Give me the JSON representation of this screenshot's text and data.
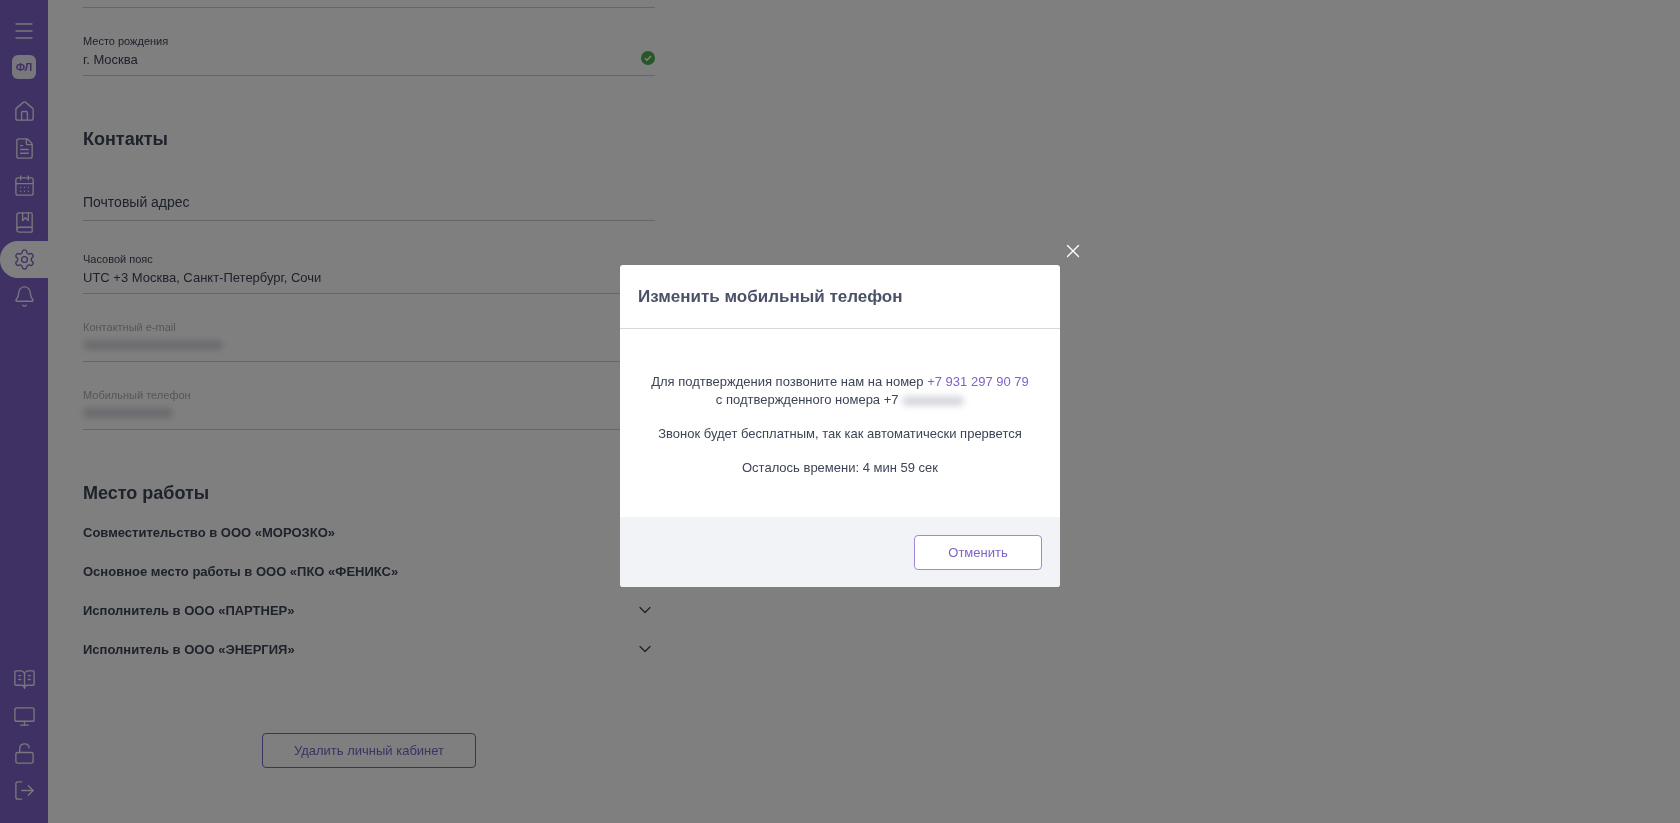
{
  "sidebar": {
    "badge": "ФЛ",
    "items": [
      {
        "selected": false
      },
      {
        "selected": false
      },
      {
        "selected": false
      },
      {
        "selected": false
      },
      {
        "selected": true
      },
      {
        "selected": false
      }
    ]
  },
  "birthplace": {
    "label": "Место рождения",
    "value": "г. Москва",
    "verified": true
  },
  "contacts": {
    "title": "Контакты",
    "fields": [
      {
        "kind": "empty",
        "placeholder": "Почтовый адрес"
      },
      {
        "kind": "filled",
        "label": "Часовой пояс",
        "value": "UTC +3 Москва, Санкт-Петербург, Сочи",
        "disabled": false
      },
      {
        "kind": "blurred",
        "label": "Контактный e-mail",
        "disabled": true
      },
      {
        "kind": "blurred",
        "label": "Мобильный телефон",
        "disabled": true
      }
    ]
  },
  "work": {
    "title": "Место работы",
    "items": [
      {
        "label": "Совместительство в ООО «МОРОЗКО»"
      },
      {
        "label": "Основное место работы в ООО «ПКО «ФЕНИКС»"
      },
      {
        "label": "Исполнитель в ООО «ПАРТНЕР»",
        "expandable": true
      },
      {
        "label": "Исполнитель в ООО «ЭНЕРГИЯ»",
        "expandable": true
      }
    ]
  },
  "delete_button": "Удалить личный кабинет",
  "modal": {
    "title": "Изменить мобильный телефон",
    "message": "Для подтверждения позвоните нам на номер",
    "phone_link": "+7 931 297 90 79",
    "confirmed_prefix": "с подтвержденного номера +7",
    "note": "Звонок будет бесплатным, так как автоматически прервется",
    "timer": "Осталось времени: 4 мин 59 сек",
    "cancel_button": "Отменить"
  }
}
